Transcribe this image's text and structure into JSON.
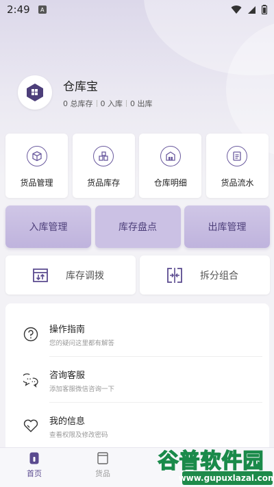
{
  "status_bar": {
    "time": "2:49",
    "notification_badge": "A",
    "icons": [
      "wifi-icon",
      "signal-icon",
      "battery-icon"
    ]
  },
  "header": {
    "app_name": "仓库宝",
    "stats": [
      "0 总库存",
      "0 入库",
      "0 出库"
    ]
  },
  "quick_actions": [
    {
      "label": "货品管理",
      "icon": "box-icon"
    },
    {
      "label": "货品库存",
      "icon": "inventory-icon"
    },
    {
      "label": "仓库明细",
      "icon": "warehouse-icon"
    },
    {
      "label": "货品流水",
      "icon": "ledger-icon"
    }
  ],
  "main_actions": [
    "入库管理",
    "库存盘点",
    "出库管理"
  ],
  "secondary_actions": [
    {
      "label": "库存调拨",
      "icon": "transfer-icon"
    },
    {
      "label": "拆分组合",
      "icon": "split-merge-icon"
    }
  ],
  "menu": [
    {
      "title": "操作指南",
      "subtitle": "您的疑问这里都有解答",
      "icon": "help-icon"
    },
    {
      "title": "咨询客服",
      "subtitle": "添加客服微信咨询一下",
      "icon": "chat-icon"
    },
    {
      "title": "我的信息",
      "subtitle": "查看权限及修改密码",
      "icon": "heart-icon"
    }
  ],
  "tabs": [
    {
      "label": "首页",
      "active": true
    },
    {
      "label": "货品",
      "active": false
    }
  ],
  "watermark": {
    "title": "谷普软件园",
    "url": "www.gupuxlazal.com"
  },
  "colors": {
    "accent": "#5a4a8f",
    "accent_light": "#cbc1e4",
    "background": "#f3f2f6"
  }
}
